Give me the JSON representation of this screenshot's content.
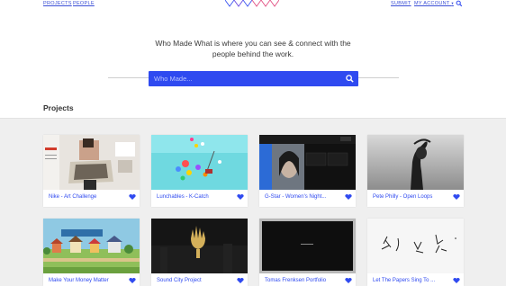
{
  "nav": {
    "projects": "PROJECTS",
    "people": "PEOPLE",
    "submit": "SUBMIT",
    "my_account": "MY ACCOUNT"
  },
  "hero": {
    "tagline": "Who Made What is where you can see & connect with the people behind the work.",
    "search_placeholder": "Who Made..."
  },
  "section": {
    "title": "Projects"
  },
  "projects": [
    {
      "title": "Nike - Art Challenge"
    },
    {
      "title": "Lunchables - K-Catch"
    },
    {
      "title": "G-Star - Women's Night..."
    },
    {
      "title": "Pete Philly - Open Loops"
    },
    {
      "title": "Make Your Money Matter"
    },
    {
      "title": "Sound City Project"
    },
    {
      "title": "Tomas Frenksen Portfolio"
    },
    {
      "title": "Let The Papers Sing To ..."
    }
  ],
  "colors": {
    "accent": "#2f4af0",
    "grid_background": "#efefef"
  }
}
